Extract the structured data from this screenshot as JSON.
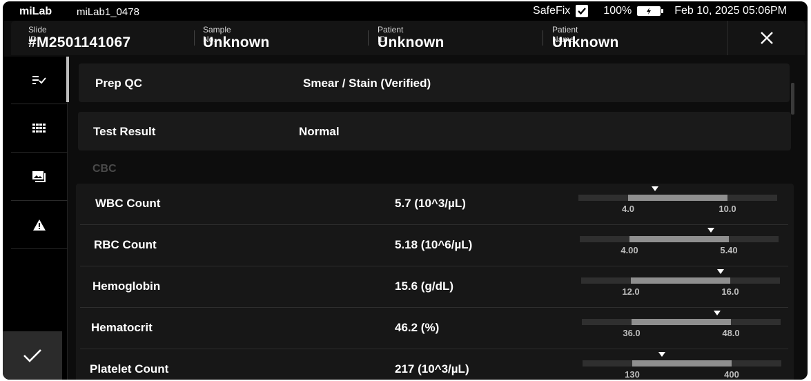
{
  "status_bar": {
    "brand": "miLab",
    "device_name": "miLab1_0478",
    "safefix_label": "SafeFix",
    "safefix_checked": true,
    "battery_percent": "100%",
    "datetime": "Feb 10, 2025 05:06PM"
  },
  "header": {
    "slide_id_label": "Slide ID",
    "slide_id_value": "#M2501141067",
    "sample_no_label": "Sample No.",
    "sample_no_value": "Unknown",
    "patient_id_label": "Patient ID",
    "patient_id_value": "Unknown",
    "patient_name_label": "Patient Name",
    "patient_name_value": "Unknown"
  },
  "sidebar": {
    "items": [
      {
        "icon": "checklist-icon",
        "active": true
      },
      {
        "icon": "grid-icon",
        "active": false
      },
      {
        "icon": "image-gallery-icon",
        "active": false
      },
      {
        "icon": "warning-icon",
        "active": false
      }
    ],
    "confirm_icon": "checkmark-icon"
  },
  "prep_qc": {
    "label": "Prep QC",
    "value": "Smear / Stain (Verified)"
  },
  "test_result": {
    "label": "Test Result",
    "value": "Normal"
  },
  "section_title": "CBC",
  "cbc_rows": [
    {
      "name": "WBC Count",
      "result": "5.7 (10^3/µL)",
      "low": "4.0",
      "high": "10.0",
      "marker": 0.385
    },
    {
      "name": "RBC Count",
      "result": "5.18 (10^6/µL)",
      "low": "4.00",
      "high": "5.40",
      "marker": 0.66
    },
    {
      "name": "Hemoglobin",
      "result": "15.6 (g/dL)",
      "low": "12.0",
      "high": "16.0",
      "marker": 0.7
    },
    {
      "name": "Hematocrit",
      "result": "46.2 (%)",
      "low": "36.0",
      "high": "48.0",
      "marker": 0.68
    },
    {
      "name": "Platelet Count",
      "result": "217 (10^3/µL)",
      "low": "130",
      "high": "400",
      "marker": 0.4
    }
  ],
  "colors": {
    "background": "#0d0d0d",
    "card": "#1a1a1a",
    "range_normal": "#8f8f8f",
    "range_track": "#2f2f2f"
  }
}
